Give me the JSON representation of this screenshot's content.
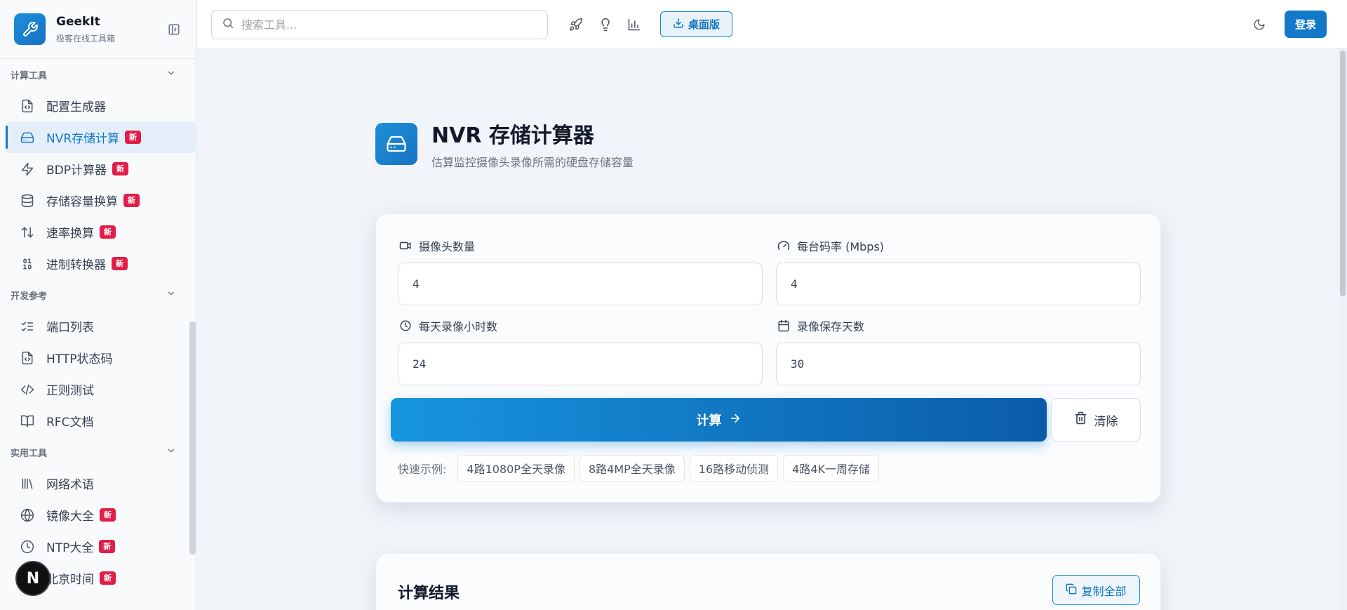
{
  "brand": {
    "name": "GeekIt",
    "subtitle": "极客在线工具箱"
  },
  "sidebar": {
    "sections": [
      {
        "title": "计算工具",
        "items": [
          {
            "label": "配置生成器",
            "icon": "file-code-icon",
            "new": false,
            "active": false
          },
          {
            "label": "NVR存储计算",
            "icon": "hard-drive-icon",
            "new": true,
            "active": true
          },
          {
            "label": "BDP计算器",
            "icon": "zap-icon",
            "new": true,
            "active": false
          },
          {
            "label": "存储容量换算",
            "icon": "database-icon",
            "new": true,
            "active": false
          },
          {
            "label": "速率换算",
            "icon": "arrow-up-down-icon",
            "new": true,
            "active": false
          },
          {
            "label": "进制转换器",
            "icon": "binary-icon",
            "new": true,
            "active": false
          }
        ]
      },
      {
        "title": "开发参考",
        "items": [
          {
            "label": "端口列表",
            "icon": "list-checks-icon",
            "new": false
          },
          {
            "label": "HTTP状态码",
            "icon": "file-code-icon",
            "new": false
          },
          {
            "label": "正则测试",
            "icon": "code-icon",
            "new": false
          },
          {
            "label": "RFC文档",
            "icon": "book-open-icon",
            "new": false
          }
        ]
      },
      {
        "title": "实用工具",
        "items": [
          {
            "label": "网络术语",
            "icon": "library-icon",
            "new": false
          },
          {
            "label": "镜像大全",
            "icon": "globe-icon",
            "new": true
          },
          {
            "label": "NTP大全",
            "icon": "clock-icon",
            "new": true
          },
          {
            "label": "北京时间",
            "icon": "clock-icon",
            "new": true
          }
        ]
      }
    ],
    "new_badge": "新",
    "floating_button": "N"
  },
  "topbar": {
    "search_placeholder": "搜索工具...",
    "desktop_label": "桌面版",
    "login_label": "登录"
  },
  "page": {
    "title": "NVR 存储计算器",
    "subtitle": "估算监控摄像头录像所需的硬盘存储容量"
  },
  "form": {
    "cameras": {
      "label": "摄像头数量",
      "value": "4"
    },
    "bitrate": {
      "label": "每台码率 (Mbps)",
      "value": "4"
    },
    "hours": {
      "label": "每天录像小时数",
      "value": "24"
    },
    "days": {
      "label": "录像保存天数",
      "value": "30"
    },
    "calc_label": "计算",
    "clear_label": "清除",
    "examples_label": "快速示例:",
    "examples": [
      "4路1080P全天录像",
      "8路4MP全天录像",
      "16路移动侦测",
      "4路4K一周存储"
    ]
  },
  "result": {
    "title": "计算结果",
    "copy_label": "复制全部"
  },
  "colors": {
    "accent": "#1179c8",
    "badge": "#e11d48"
  }
}
